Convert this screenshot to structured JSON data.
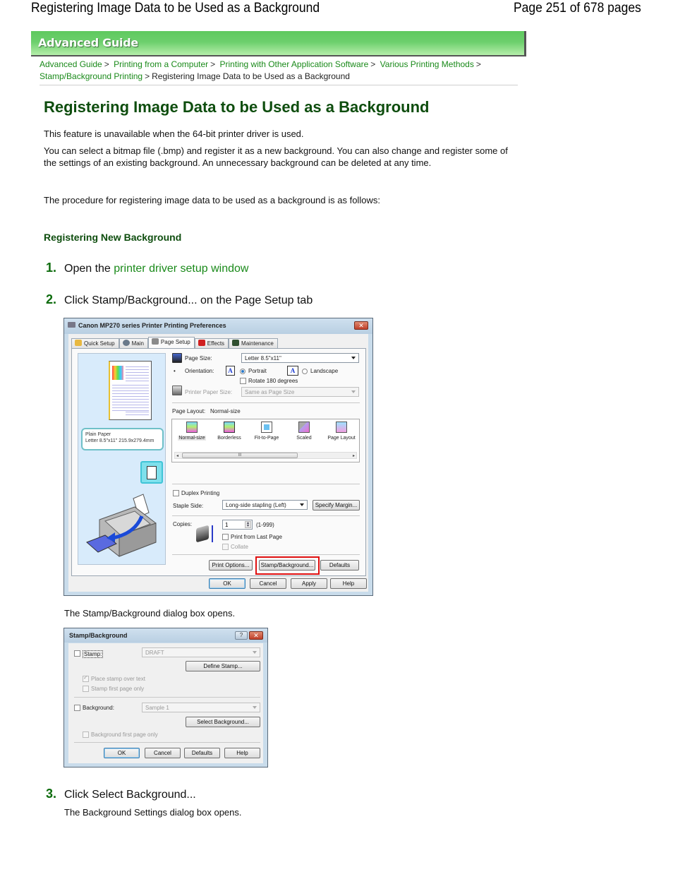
{
  "page_header": {
    "title": "Registering Image Data to be Used as a Background",
    "page_info": "Page 251 of 678 pages"
  },
  "banner": {
    "label": "Advanced Guide"
  },
  "breadcrumb": {
    "items": [
      {
        "label": "Advanced Guide",
        "link": true
      },
      {
        "label": "Printing from a Computer",
        "link": true
      },
      {
        "label": "Printing with Other Application Software",
        "link": true
      },
      {
        "label": "Various Printing Methods",
        "link": true
      },
      {
        "label": "Stamp/Background Printing",
        "link": true
      },
      {
        "label": "Registering Image Data to be Used as a Background",
        "link": false
      }
    ],
    "separator": ">"
  },
  "article": {
    "heading": "Registering Image Data to be Used as a Background",
    "paragraphs": [
      "This feature is unavailable when the 64-bit printer driver is used.",
      "You can select a bitmap file (.bmp) and register it as a new background. You can also change and register some of the settings of an existing background. An unnecessary background can be deleted at any time.",
      "The procedure for registering image data to be used as a background is as follows:"
    ],
    "subheading": "Registering New Background",
    "steps": [
      {
        "num": "1.",
        "text": "Open the ",
        "link": "printer driver setup window"
      },
      {
        "num": "2.",
        "text": "Click Stamp/Background... on the Page Setup tab"
      },
      {
        "num": "3.",
        "text": "Click Select Background..."
      }
    ],
    "notes": {
      "after_step2_dialog": "The Stamp/Background dialog box opens.",
      "after_step3": "The Background Settings dialog box opens."
    }
  },
  "printer_dialog": {
    "title": "Canon MP270 series Printer Printing Preferences",
    "close_icon": "close-icon",
    "tabs": [
      {
        "label": "Quick Setup",
        "icon": "quick-setup-icon",
        "active": false
      },
      {
        "label": "Main",
        "icon": "main-icon",
        "active": false
      },
      {
        "label": "Page Setup",
        "icon": "page-setup-icon",
        "active": true
      },
      {
        "label": "Effects",
        "icon": "effects-icon",
        "active": false
      },
      {
        "label": "Maintenance",
        "icon": "maintenance-icon",
        "active": false
      }
    ],
    "preview": {
      "paper_type": "Plain Paper",
      "paper_size": "Letter 8.5\"x11\" 215.9x279.4mm"
    },
    "page_size_label": "Page Size:",
    "page_size_value": "Letter 8.5\"x11\"",
    "orientation_label": "Orientation:",
    "portrait_label": "Portrait",
    "landscape_label": "Landscape",
    "orientation_selected": "Portrait",
    "rotate_label": "Rotate 180 degrees",
    "printer_paper_size_label": "Printer Paper Size:",
    "printer_paper_size_value": "Same as Page Size",
    "page_layout_label": "Page Layout:",
    "page_layout_value": "Normal-size",
    "layouts": [
      "Normal-size",
      "Borderless",
      "Fit-to-Page",
      "Scaled",
      "Page Layout"
    ],
    "scroll_grip": "III",
    "duplex_label": "Duplex Printing",
    "staple_side_label": "Staple Side:",
    "staple_side_value": "Long-side stapling (Left)",
    "specify_margin_label": "Specify Margin...",
    "copies_label": "Copies:",
    "copies_value": "1",
    "copies_range": "(1-999)",
    "print_last_page_label": "Print from Last Page",
    "collate_label": "Collate",
    "print_options_label": "Print Options...",
    "stamp_background_label": "Stamp/Background...",
    "defaults_label": "Defaults",
    "ok_label": "OK",
    "cancel_label": "Cancel",
    "apply_label": "Apply",
    "help_label": "Help"
  },
  "stamp_dialog": {
    "title": "Stamp/Background",
    "help_icon": "?",
    "stamp_label": "Stamp:",
    "stamp_value": "DRAFT",
    "define_stamp_label": "Define Stamp...",
    "place_over_text_label": "Place stamp over text",
    "stamp_first_page_label": "Stamp first page only",
    "background_label": "Background:",
    "background_value": "Sample 1",
    "select_background_label": "Select Background...",
    "background_first_page_label": "Background first page only",
    "ok_label": "OK",
    "cancel_label": "Cancel",
    "defaults_label": "Defaults",
    "help_label": "Help"
  },
  "colors": {
    "heading_green": "#0e4d0e",
    "link_green": "#1a8a1a",
    "banner_green": "#6ccf6c",
    "highlight_red": "#e01010"
  }
}
